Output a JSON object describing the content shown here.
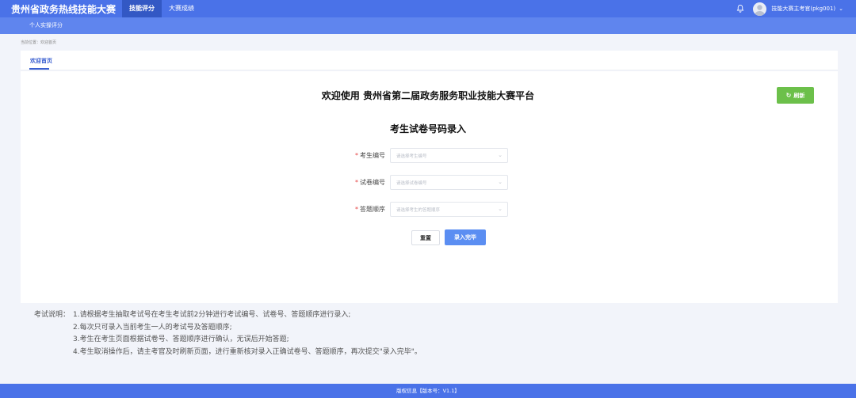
{
  "header": {
    "title": "贵州省政务热线技能大赛",
    "nav": [
      {
        "label": "技能评分",
        "active": true
      },
      {
        "label": "大赛成绩",
        "active": false
      }
    ],
    "user_name": "技能大赛主考官(pkg001)"
  },
  "subnav": {
    "label": "个人实操评分"
  },
  "breadcrumb": "当前位置：欢迎首页",
  "tab": {
    "label": "欢迎首页"
  },
  "refresh_label": "刷新",
  "main_title": "欢迎使用 贵州省第二届政务服务职业技能大赛平台",
  "form_title": "考生试卷号码录入",
  "form": {
    "fields": [
      {
        "label": "考生编号",
        "placeholder": "请选择考生编号"
      },
      {
        "label": "试卷编号",
        "placeholder": "请选择试卷编号"
      },
      {
        "label": "答题顺序",
        "placeholder": "请选择考生的答题顺序"
      }
    ],
    "reset_label": "重置",
    "submit_label": "录入完毕"
  },
  "notes": {
    "label": "考试说明：",
    "lines": [
      "1.请根据考生抽取考试号在考生考试前2分钟进行考试编号、试卷号、答题顺序进行录入;",
      "2.每次只可录入当前考生一人的考试号及答题顺序;",
      "3.考生在考生页面根据试卷号、答题顺序进行确认，无误后开始答题;",
      "4.考生取消操作后，请主考官及时刷新页面，进行重新核对录入正确试卷号、答题顺序，再次提交\"录入完毕\"。"
    ]
  },
  "footer": "版权信息【版本号：V1.1】",
  "colors": {
    "primary": "#4a72e8",
    "success": "#6cc04a",
    "submit": "#5b8ef2"
  }
}
